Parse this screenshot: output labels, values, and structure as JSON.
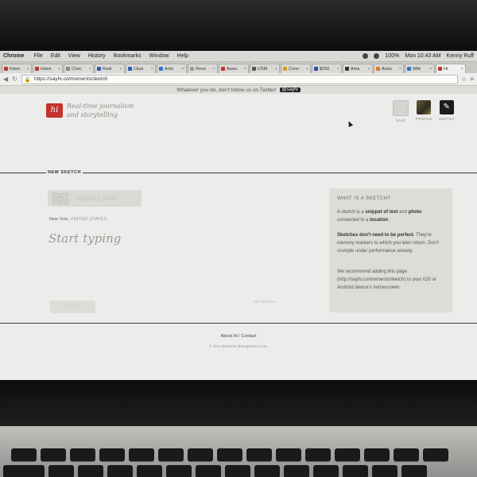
{
  "menubar": {
    "app": "Chrome",
    "items": [
      "File",
      "Edit",
      "View",
      "History",
      "Bookmarks",
      "Window",
      "Help"
    ],
    "status": {
      "battery": "100%",
      "time": "Mon 10:43 AM",
      "user": "Kenny Ruff"
    }
  },
  "tabs": [
    {
      "label": "Inbox",
      "color": "#c4332c"
    },
    {
      "label": "Inbox",
      "color": "#c4332c"
    },
    {
      "label": "Chec",
      "color": "#888888"
    },
    {
      "label": "Rodi",
      "color": "#2a5db0"
    },
    {
      "label": "Closi",
      "color": "#2a5db0"
    },
    {
      "label": "Acto",
      "color": "#3a6fc9"
    },
    {
      "label": "Revo",
      "color": "#999999"
    },
    {
      "label": "Assis",
      "color": "#c4332c"
    },
    {
      "label": "USM",
      "color": "#555555"
    },
    {
      "label": "Conv",
      "color": "#d4a017"
    },
    {
      "label": "$250",
      "color": "#2a4fa0"
    },
    {
      "label": "Ama",
      "color": "#333333"
    },
    {
      "label": "Assis",
      "color": "#e07a1f"
    },
    {
      "label": "Wiki",
      "color": "#2a7ac0"
    },
    {
      "label": "Hi",
      "color": "#c4332c"
    }
  ],
  "toolbar": {
    "url": "https://sayhi.co/moments/sketch"
  },
  "banner": {
    "text": "Whatever you do, don't follow us on Twitter!",
    "handle": "@sayhi"
  },
  "brand": {
    "logo_text": "hi",
    "tagline": "Real-time journalism and storytelling"
  },
  "nav": {
    "save": "SAVE",
    "profile": "PROFILE",
    "sketch": "SKETCH"
  },
  "compose": {
    "section_label": "NEW SKETCH",
    "upload_label": "Upload a photo",
    "city": "New York,",
    "country": "UNITED STATES",
    "placeholder": "Start typing",
    "word_count": "100 WORDS",
    "submit": "READY"
  },
  "aside": {
    "heading": "WHAT IS A SKETCH?",
    "p1_a": "A sketch is a ",
    "p1_b": "snippet of text",
    "p1_c": " and ",
    "p1_d": "photo",
    "p1_e": " connected to a ",
    "p1_f": "location",
    "p1_g": ".",
    "p2_a": "Sketches don't need to be perfect.",
    "p2_b": " They're memory markers to which you later return. Don't crumple under performance anxiety.",
    "p3": "We recommend adding this page (http://sayhi.co/moments/sketch) to your iOS or Android device's homescreen."
  },
  "footer": {
    "links": "About Hi / Contact",
    "copyright": "© 2013 Momento Management Corp."
  }
}
